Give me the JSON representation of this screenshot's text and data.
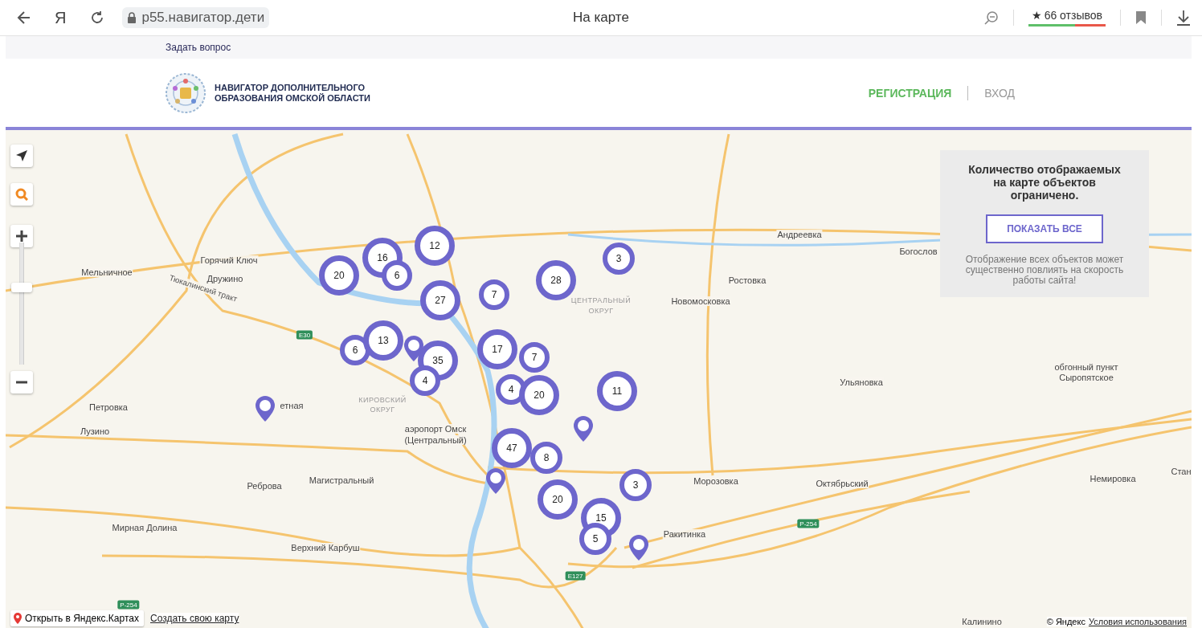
{
  "browser": {
    "logo_letter": "Я",
    "url": "p55.навигатор.дети",
    "page_title": "На карте",
    "rating_star": "★",
    "rating_text": "66 отзывов"
  },
  "site": {
    "top_link": "Задать вопрос",
    "title_lines": [
      "НАВИГАТОР ДОПОЛНИТЕЛЬНОГО",
      "ОБРАЗОВАНИЯ ОМСКОЙ ОБЛАСТИ"
    ],
    "nav": [
      {
        "label": "РЕГИСТРАЦИЯ",
        "kind": "accent"
      },
      {
        "label": "ВХОД",
        "kind": "plain"
      }
    ]
  },
  "map": {
    "zoom": {
      "level": 0.63
    },
    "notice": {
      "title": "Количество отображаемых на карте объектов ограничено.",
      "button": "ПОКАЗАТЬ ВСЕ",
      "note": "Отображение всех объектов может существенно повлиять на скорость работы сайта!"
    },
    "clusters": [
      "20",
      "16",
      "6",
      "12",
      "27",
      "7",
      "28",
      "3",
      "6",
      "13",
      "35",
      "4",
      "17",
      "7",
      "4",
      "20",
      "11",
      "47",
      "8",
      "3",
      "20",
      "15",
      "5"
    ],
    "places": [
      {
        "text": "Горячий Ключ",
        "kind": "town"
      },
      {
        "text": "Дружино",
        "kind": "town"
      },
      {
        "text": "Мельничное",
        "kind": "town"
      },
      {
        "text": "Петровка",
        "kind": "town"
      },
      {
        "text": "Лузино",
        "kind": "town"
      },
      {
        "text": "етная",
        "kind": "town"
      },
      {
        "text": "Реброва",
        "kind": "town"
      },
      {
        "text": "Магистральный",
        "kind": "town"
      },
      {
        "text": "Мирная Долина",
        "kind": "town"
      },
      {
        "text": "Верхний Карбуш",
        "kind": "town"
      },
      {
        "text": "Андреевка",
        "kind": "town"
      },
      {
        "text": "Ростовка",
        "kind": "town"
      },
      {
        "text": "Новомосковка",
        "kind": "town"
      },
      {
        "text": "Богослов",
        "kind": "town"
      },
      {
        "text": "Ульяновка",
        "kind": "town"
      },
      {
        "text": "обгонный пункт",
        "kind": "town"
      },
      {
        "text": "Сыропятское",
        "kind": "town"
      },
      {
        "text": "Морозовка",
        "kind": "town"
      },
      {
        "text": "Октябрьский",
        "kind": "town"
      },
      {
        "text": "Немировка",
        "kind": "town"
      },
      {
        "text": "Стан",
        "kind": "town"
      },
      {
        "text": "Ракитинка",
        "kind": "town"
      },
      {
        "text": "Калинино",
        "kind": "town"
      },
      {
        "text": "аэропорт Омск",
        "kind": "town"
      },
      {
        "text": "(Центральный)",
        "kind": "town"
      },
      {
        "text": "ЦЕНТРАЛЬНЫЙ",
        "kind": "district"
      },
      {
        "text": "ОКРУГ",
        "kind": "district"
      },
      {
        "text": "КИРОВСКИЙ",
        "kind": "district"
      },
      {
        "text": "ОКРУГ",
        "kind": "district"
      },
      {
        "text": "Тюкалинский тракт",
        "kind": "road"
      },
      {
        "text": "E30",
        "kind": "shield"
      },
      {
        "text": "P-254",
        "kind": "shield"
      },
      {
        "text": "P-254",
        "kind": "shield"
      },
      {
        "text": "E127",
        "kind": "shield"
      }
    ],
    "open_button": "Открыть в Яндекс.Картах",
    "create_link": "Создать свою карту",
    "copyright": "© Яндекс",
    "terms_link": "Условия использования"
  }
}
